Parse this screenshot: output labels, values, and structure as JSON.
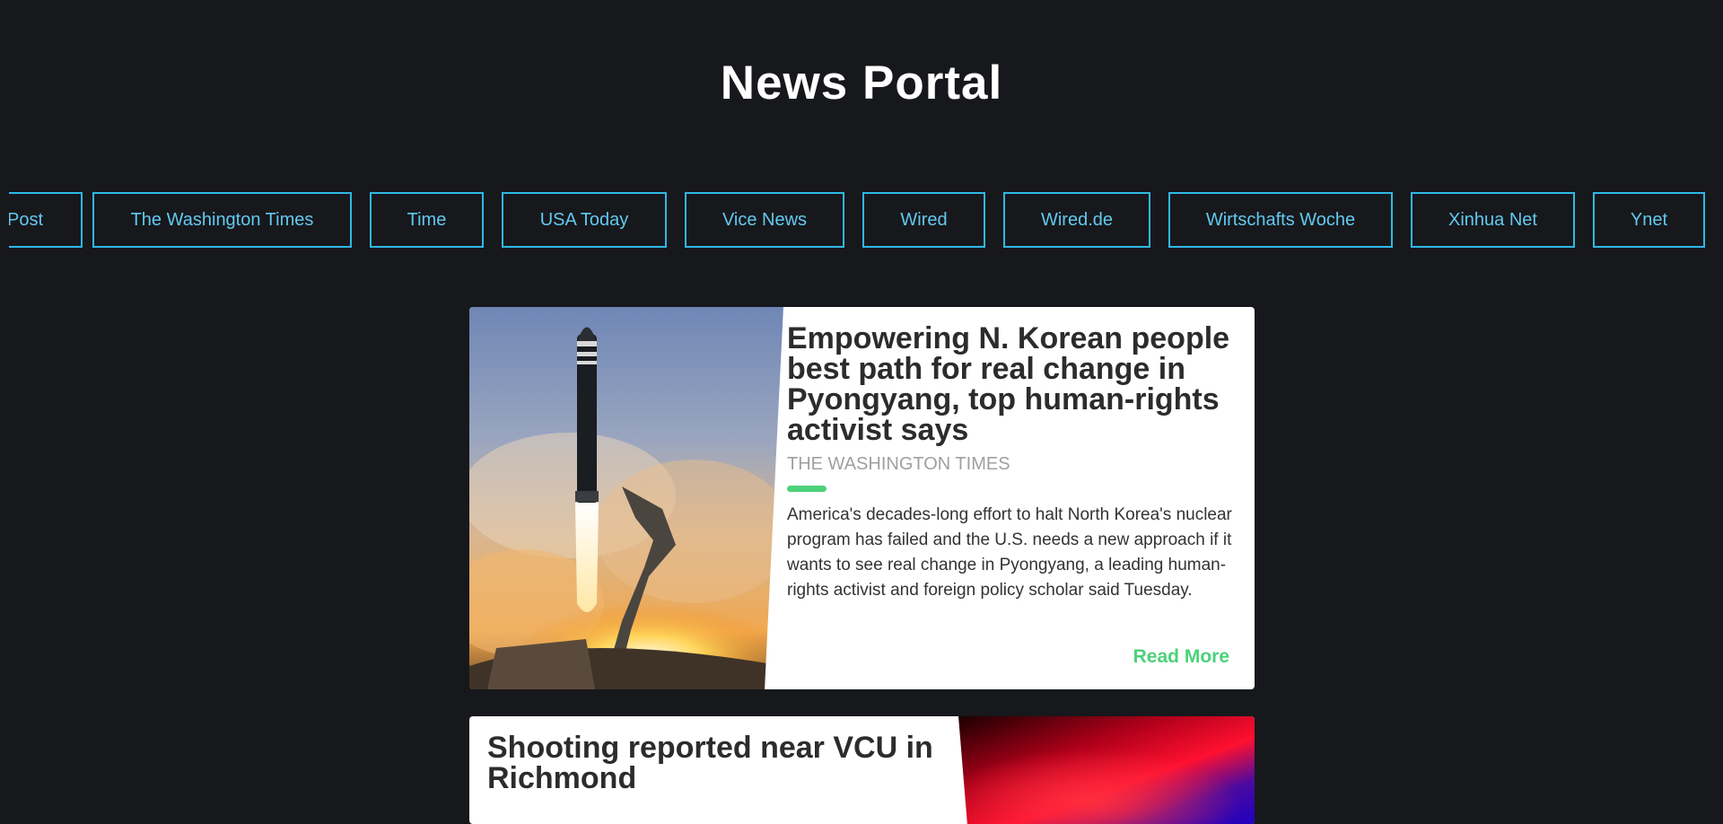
{
  "header": {
    "title": "News Portal"
  },
  "sources": [
    {
      "label": "Post"
    },
    {
      "label": "The Washington Times"
    },
    {
      "label": "Time"
    },
    {
      "label": "USA Today"
    },
    {
      "label": "Vice News"
    },
    {
      "label": "Wired"
    },
    {
      "label": "Wired.de"
    },
    {
      "label": "Wirtschafts Woche"
    },
    {
      "label": "Xinhua Net"
    },
    {
      "label": "Ynet"
    }
  ],
  "articles": [
    {
      "headline": "Empowering N. Korean people best path for real change in Pyongyang, top human-rights activist says",
      "source": "THE WASHINGTON TIMES",
      "summary": "America's decades-long effort to halt North Korea's nuclear program has failed and the U.S. needs a new approach if it wants to see real change in Pyongyang, a leading human-rights activist and foreign policy scholar said Tuesday.",
      "read_more": "Read More",
      "image": "missile-launch-photo"
    },
    {
      "headline": "Shooting reported near VCU in Richmond",
      "image": "police-lights-photo"
    }
  ],
  "colors": {
    "background": "#17181c",
    "source_border": "#2fb8e6",
    "accent": "#4cd17b"
  }
}
